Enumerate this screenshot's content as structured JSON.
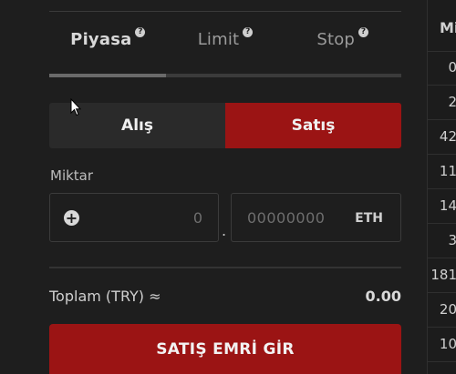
{
  "tabs": [
    {
      "label": "Piyasa",
      "help": "?"
    },
    {
      "label": "Limit",
      "help": "?"
    },
    {
      "label": "Stop",
      "help": "?"
    }
  ],
  "side": {
    "buy_label": "Alış",
    "sell_label": "Satış"
  },
  "amount": {
    "label": "Miktar",
    "integer_value": "0",
    "decimal_separator": ".",
    "decimal_placeholder": "00000000",
    "unit": "ETH"
  },
  "total": {
    "label": "Toplam (TRY) ≈",
    "value": "0.00"
  },
  "submit": {
    "label": "SATIŞ EMRİ GİR"
  },
  "order_list": {
    "header": "Mi",
    "rows": [
      "0",
      "2",
      "42",
      "11",
      "14",
      "3",
      "181",
      "20",
      "10"
    ]
  },
  "colors": {
    "sell_accent": "#9b1414",
    "background": "#1e1e1e"
  },
  "icons": {
    "plus": "plus-circle-icon",
    "help": "question-circle-icon",
    "cursor": "mouse-pointer-icon"
  }
}
